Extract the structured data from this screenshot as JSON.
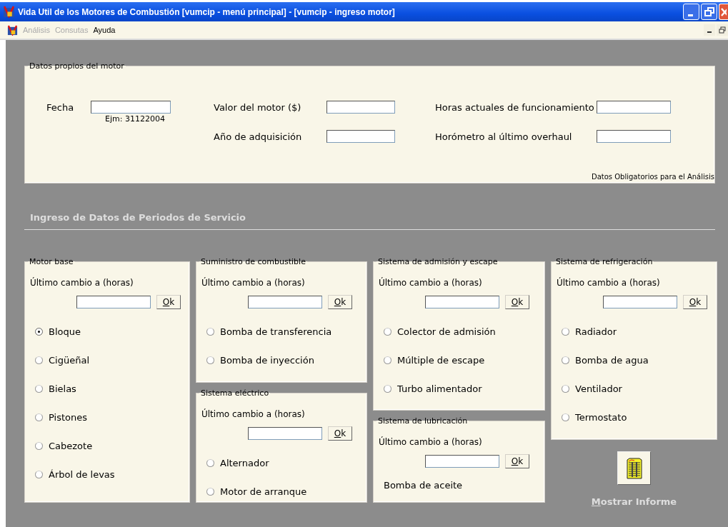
{
  "window": {
    "title": "Vida Util de los Motores de Combustión [vumcip - menú principal] - [vumcip - ingreso motor]"
  },
  "menu": [
    {
      "label": "Análisis",
      "disabled": true
    },
    {
      "label": "Consutas",
      "disabled": true
    },
    {
      "label": "Ayuda",
      "disabled": false
    }
  ],
  "engine_data": {
    "title": "Datos propios del motor",
    "fields": [
      {
        "label": "Fecha",
        "hint": "Ejm: 31122004"
      },
      {
        "label": "Valor del motor ($)"
      },
      {
        "label": "Año de adquisición"
      },
      {
        "label": "Horas actuales de funcionamiento"
      },
      {
        "label": "Horómetro al último overhaul"
      }
    ],
    "note": "Datos Obligatorios para el Análisis"
  },
  "section_title": "Ingreso de Datos de Periodos de Servicio",
  "columns": [
    {
      "groups": [
        {
          "title": "Motor base",
          "field_label": "Último cambio a (horas)",
          "button": "Ok",
          "items": [
            {
              "kind": "radio",
              "label": "Bloque",
              "selected": true
            },
            {
              "kind": "radio",
              "label": "Cigüeñal",
              "selected": false
            },
            {
              "kind": "radio",
              "label": "Bielas",
              "selected": false
            },
            {
              "kind": "radio",
              "label": "Pistones",
              "selected": false
            },
            {
              "kind": "radio",
              "label": "Cabezote",
              "selected": false
            },
            {
              "kind": "radio",
              "label": "Árbol de levas",
              "selected": false
            }
          ]
        }
      ]
    },
    {
      "groups": [
        {
          "title": "Suministro de combustible",
          "field_label": "Último cambio a (horas)",
          "button": "Ok",
          "items": [
            {
              "kind": "radio",
              "label": "Bomba de transferencia",
              "selected": false
            },
            {
              "kind": "radio",
              "label": "Bomba de inyección",
              "selected": false
            }
          ]
        },
        {
          "title": "Sistema eléctrico",
          "field_label": "Último cambio a (horas)",
          "button": "Ok",
          "items": [
            {
              "kind": "radio",
              "label": "Alternador",
              "selected": false
            },
            {
              "kind": "radio",
              "label": "Motor de arranque",
              "selected": false
            }
          ]
        }
      ]
    },
    {
      "groups": [
        {
          "title": "Sistema de admisión y escape",
          "field_label": "Último cambio a (horas)",
          "button": "Ok",
          "items": [
            {
              "kind": "radio",
              "label": "Colector de admisión",
              "selected": false
            },
            {
              "kind": "radio",
              "label": "Múltiple de escape",
              "selected": false
            },
            {
              "kind": "radio",
              "label": "Turbo alimentador",
              "selected": false
            }
          ]
        },
        {
          "title": "Sistema de lubricación",
          "field_label": "Último cambio a (horas)",
          "button": "Ok",
          "items": [
            {
              "kind": "label",
              "label": "Bomba de aceite"
            }
          ]
        }
      ]
    },
    {
      "groups": [
        {
          "title": "Sistema de refrigeración",
          "field_label": "Último cambio a (horas)",
          "button": "Ok",
          "items": [
            {
              "kind": "radio",
              "label": "Radiador",
              "selected": false
            },
            {
              "kind": "radio",
              "label": "Bomba de agua",
              "selected": false
            },
            {
              "kind": "radio",
              "label": "Ventilador",
              "selected": false
            },
            {
              "kind": "radio",
              "label": "Termostato",
              "selected": false
            }
          ]
        }
      ]
    }
  ],
  "report_button": {
    "label": "Mostrar Informe"
  }
}
